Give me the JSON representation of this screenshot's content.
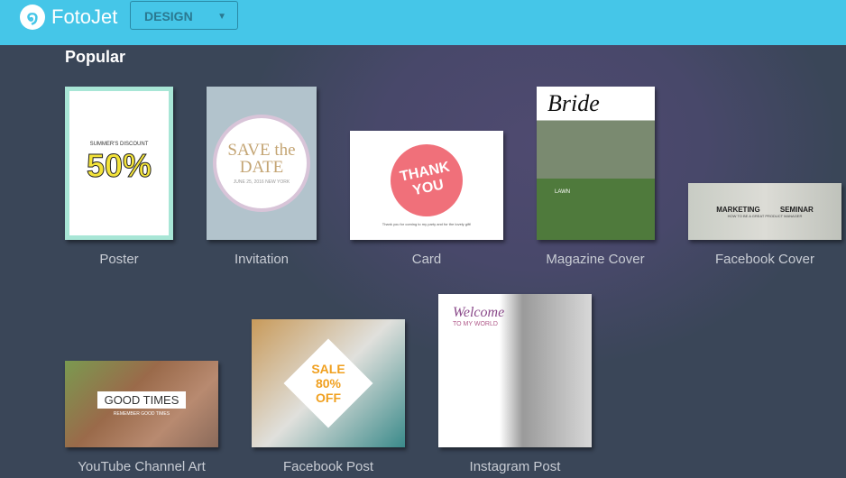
{
  "header": {
    "brand": "FotoJet",
    "dropdown": "DESIGN"
  },
  "section_title": "Popular",
  "templates": [
    {
      "label": "Poster",
      "text": "50%",
      "sub": "SUMMER'S DISCOUNT"
    },
    {
      "label": "Invitation",
      "text": "SAVE the DATE",
      "sub": "JUNE 25, 2016 NEW YORK"
    },
    {
      "label": "Card",
      "text": "THANK YOU",
      "sub": "Thank you for coming to my party and for the lovely gift!"
    },
    {
      "label": "Magazine Cover",
      "text": "Bride",
      "sub": "LAWN"
    },
    {
      "label": "Facebook Cover",
      "text": "MARKETING SEMINAR",
      "sub": "HOW TO BE A GREAT PRODUCT MANAGER"
    },
    {
      "label": "YouTube Channel Art",
      "text": "GOOD TIMES",
      "sub": "REMEMBER GOOD TIMES"
    },
    {
      "label": "Facebook Post",
      "text": "SALE 80% OFF",
      "sub": ""
    },
    {
      "label": "Instagram Post",
      "text": "Welcome",
      "sub": "TO MY WORLD"
    }
  ]
}
